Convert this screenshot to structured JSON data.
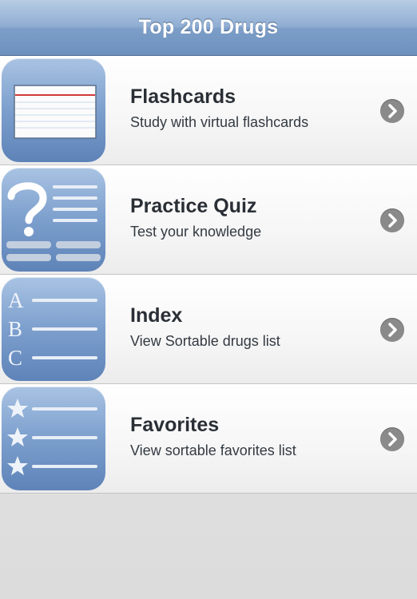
{
  "navbar": {
    "title": "Top 200 Drugs"
  },
  "menu": {
    "items": [
      {
        "title": "Flashcards",
        "subtitle": "Study with virtual flashcards",
        "icon": "flashcard-icon"
      },
      {
        "title": "Practice Quiz",
        "subtitle": "Test your knowledge",
        "icon": "quiz-icon"
      },
      {
        "title": "Index",
        "subtitle": "View Sortable drugs list",
        "icon": "abc-index-icon"
      },
      {
        "title": "Favorites",
        "subtitle": "View sortable favorites list",
        "icon": "star-list-icon"
      }
    ]
  },
  "index_icon_letters": [
    "A",
    "B",
    "C"
  ],
  "colors": {
    "navbar": "#8fadd2",
    "icon_blue": "#7c9fcd",
    "chevron": "#8a8a8a",
    "flashcard_line": "#d23a3a"
  }
}
